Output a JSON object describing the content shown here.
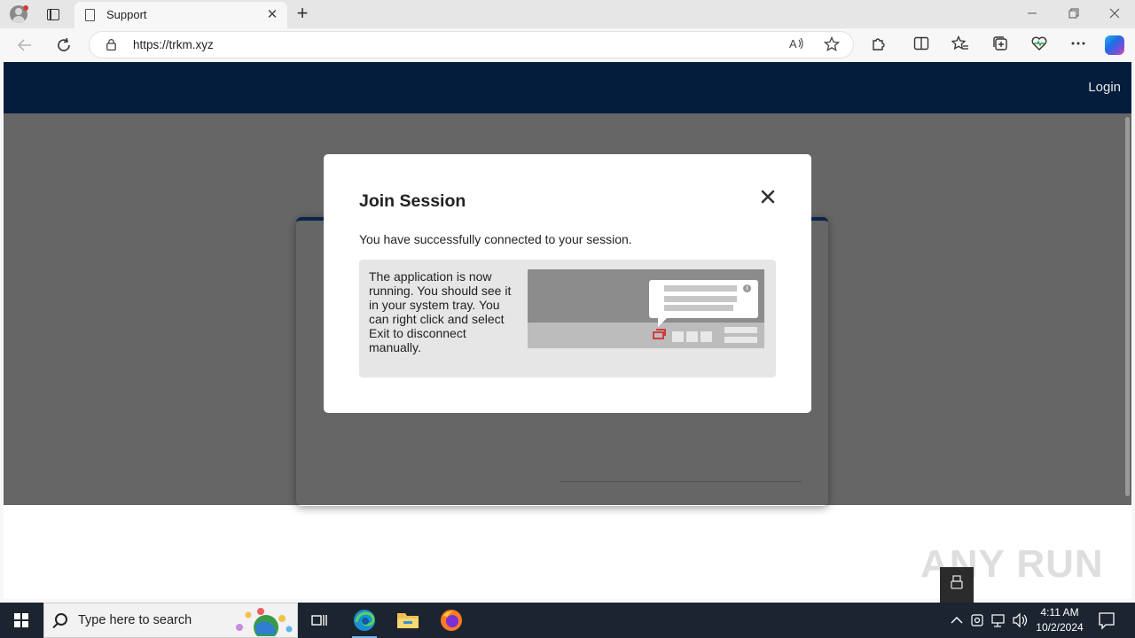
{
  "browser": {
    "tab_title": "Support",
    "url": "https://trkm.xyz",
    "new_tab_symbol": "+",
    "tab_close_symbol": "✕"
  },
  "site": {
    "login_label": "Login"
  },
  "modal": {
    "title": "Join Session",
    "close_symbol": "✕",
    "message": "You have successfully connected to your session.",
    "info_text": "The application is now running. You should see it in your system tray. You can right click and select Exit to disconnect manually."
  },
  "taskbar": {
    "search_placeholder": "Type here to search",
    "time": "4:11 AM",
    "date": "10/2/2024"
  },
  "watermark": "ANY RUN",
  "colors": {
    "site_header": "#051d3c",
    "overlay": "rgba(0,0,0,0.6)",
    "taskbar": "#1c2430",
    "card_accent": "#1b5fb8"
  },
  "icons": {
    "back": "arrow-left-icon",
    "refresh": "refresh-icon",
    "lock": "lock-icon",
    "read_aloud": "read-aloud-icon",
    "favorite": "star-icon",
    "extensions": "puzzle-icon",
    "split": "split-screen-icon",
    "favorites": "favorites-icon",
    "collections": "collections-icon",
    "performance": "heart-pulse-icon",
    "more": "ellipsis-icon",
    "copilot": "copilot-icon"
  }
}
